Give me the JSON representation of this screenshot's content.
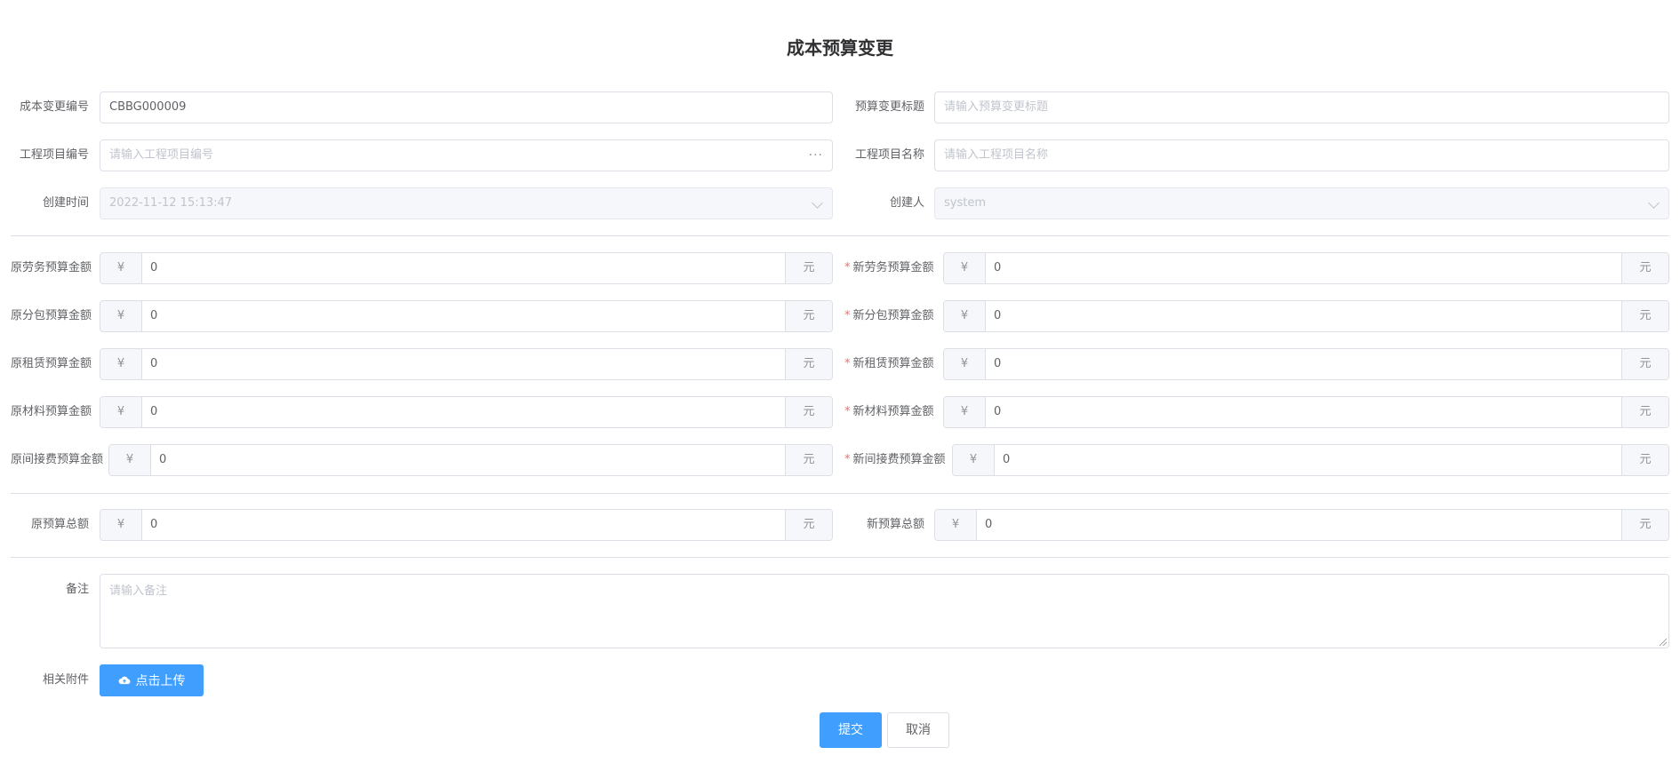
{
  "page": {
    "title": "成本预算变更"
  },
  "fields": {
    "cost_change_no": {
      "label": "成本变更编号",
      "value": "CBBG000009"
    },
    "budget_change_title": {
      "label": "预算变更标题",
      "placeholder": "请输入预算变更标题"
    },
    "project_no": {
      "label": "工程项目编号",
      "placeholder": "请输入工程项目编号",
      "suffix": "···"
    },
    "project_name": {
      "label": "工程项目名称",
      "placeholder": "请输入工程项目名称"
    },
    "created_time": {
      "label": "创建时间",
      "value": "2022-11-12 15:13:47"
    },
    "creator": {
      "label": "创建人",
      "value": "system"
    }
  },
  "currency": {
    "prefix": "¥",
    "suffix": "元"
  },
  "amounts": {
    "orig_labor": {
      "label": "原劳务预算金额",
      "value": "0"
    },
    "new_labor": {
      "label": "新劳务预算金额",
      "value": "0",
      "required": "*"
    },
    "orig_sub": {
      "label": "原分包预算金额",
      "value": "0"
    },
    "new_sub": {
      "label": "新分包预算金额",
      "value": "0",
      "required": "*"
    },
    "orig_rent": {
      "label": "原租赁预算金额",
      "value": "0"
    },
    "new_rent": {
      "label": "新租赁预算金额",
      "value": "0",
      "required": "*"
    },
    "orig_material": {
      "label": "原材料预算金额",
      "value": "0"
    },
    "new_material": {
      "label": "新材料预算金额",
      "value": "0",
      "required": "*"
    },
    "orig_indirect": {
      "label": "原间接费预算金额",
      "value": "0"
    },
    "new_indirect": {
      "label": "新间接费预算金额",
      "value": "0",
      "required": "*"
    },
    "orig_total": {
      "label": "原预算总额",
      "value": "0"
    },
    "new_total": {
      "label": "新预算总额",
      "value": "0"
    }
  },
  "remark": {
    "label": "备注",
    "placeholder": "请输入备注"
  },
  "attachment": {
    "label": "相关附件",
    "button": "点击上传"
  },
  "actions": {
    "submit": "提交",
    "cancel": "取消"
  }
}
